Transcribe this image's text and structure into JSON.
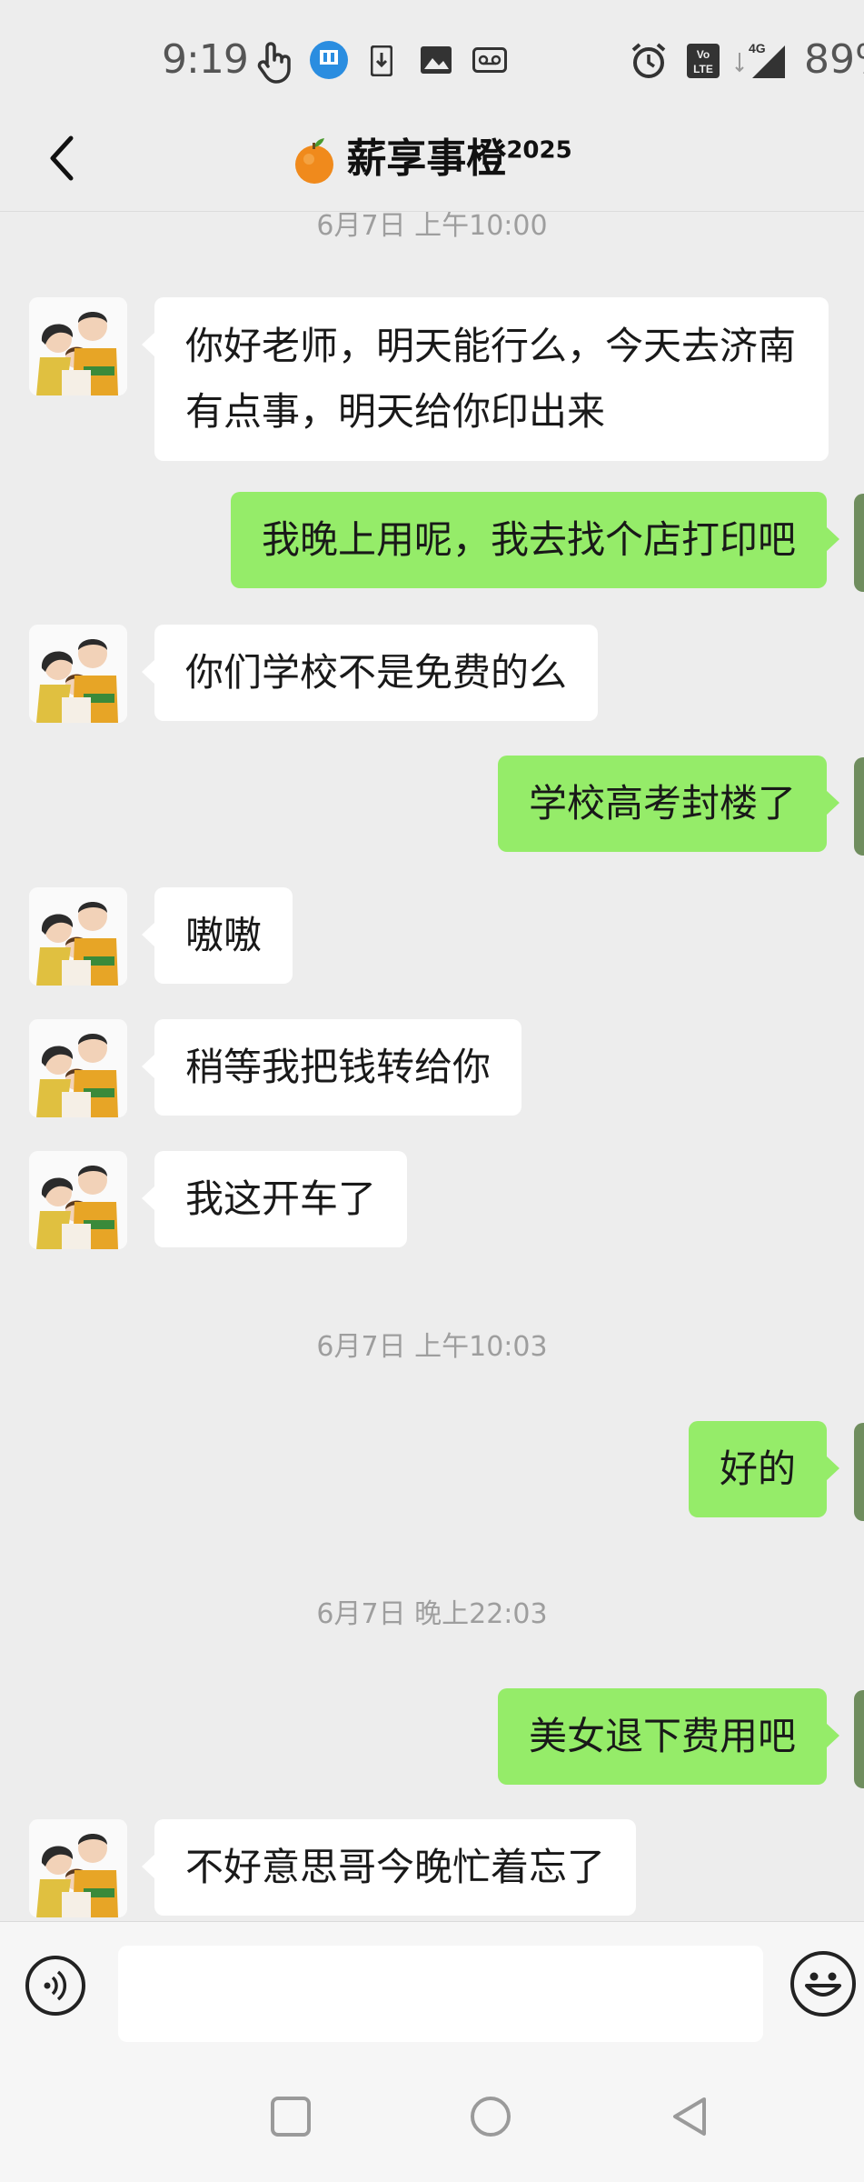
{
  "status_bar": {
    "time": "9:19",
    "battery": "89%",
    "network": "4G",
    "volte": "Vo LTE",
    "icons": [
      "hand-touch-icon",
      "app-badge-icon",
      "download-icon",
      "image-icon",
      "tape-icon",
      "alarm-icon",
      "volte-icon",
      "signal-icon"
    ]
  },
  "header": {
    "title_emoji": "🍊",
    "title": "薪享事橙",
    "title_suffix": "2025"
  },
  "chat": {
    "timestamps": [
      "6月7日 上午10:00",
      "6月7日 上午10:03",
      "6月7日 晚上22:03"
    ],
    "messages": [
      {
        "side": "left",
        "text": "你好老师，明天能行么，今天去济南有点事，明天给你印出来"
      },
      {
        "side": "right",
        "text": "我晚上用呢，我去找个店打印吧"
      },
      {
        "side": "left",
        "text": "你们学校不是免费的么"
      },
      {
        "side": "right",
        "text": "学校高考封楼了"
      },
      {
        "side": "left",
        "text": "嗷嗷"
      },
      {
        "side": "left",
        "text": "稍等我把钱转给你"
      },
      {
        "side": "left",
        "text": "我这开车了"
      },
      {
        "side": "right",
        "text": "好的"
      },
      {
        "side": "right",
        "text": "美女退下费用吧"
      },
      {
        "side": "left",
        "text": "不好意思哥今晚忙着忘了"
      }
    ]
  },
  "input_bar": {
    "value": "",
    "placeholder": ""
  },
  "colors": {
    "background": "#ededed",
    "sent_bubble": "#95ec69",
    "received_bubble": "#ffffff"
  }
}
